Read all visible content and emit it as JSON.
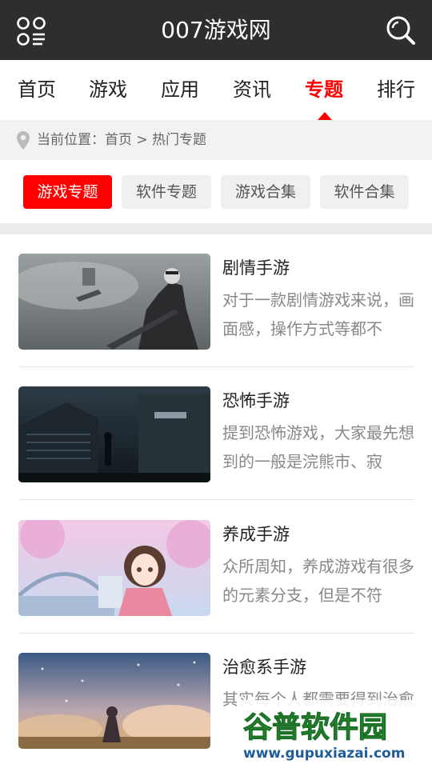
{
  "header": {
    "title": "007游戏网",
    "menu_icon": "grid-menu-icon",
    "search_icon": "search-icon"
  },
  "nav": {
    "tabs": [
      {
        "label": "首页"
      },
      {
        "label": "游戏"
      },
      {
        "label": "应用"
      },
      {
        "label": "资讯"
      },
      {
        "label": "专题",
        "active": true
      },
      {
        "label": "排行"
      }
    ]
  },
  "breadcrumb": {
    "text": "当前位置：首页 > 热门专题",
    "icon": "location-pin-icon"
  },
  "filters": [
    {
      "label": "游戏专题",
      "active": true
    },
    {
      "label": "软件专题"
    },
    {
      "label": "游戏合集"
    },
    {
      "label": "软件合集"
    }
  ],
  "topics": [
    {
      "title": "剧情手游",
      "desc": "对于一款剧情游戏来说，画面感，操作方式等都不"
    },
    {
      "title": "恐怖手游",
      "desc": "提到恐怖游戏，大家最先想到的一般是浣熊市、寂"
    },
    {
      "title": "养成手游",
      "desc": "众所周知，养成游戏有很多的元素分支，但是不符"
    },
    {
      "title": "治愈系手游",
      "desc": "其实每个人都需要得到治愈"
    }
  ],
  "watermark": {
    "brand": "谷普软件园",
    "url": "www.gupuxiazai.com"
  },
  "colors": {
    "header_bg": "#2e2e2e",
    "accent": "#ff0000",
    "breadcrumb_bg": "#f2f2f2"
  }
}
